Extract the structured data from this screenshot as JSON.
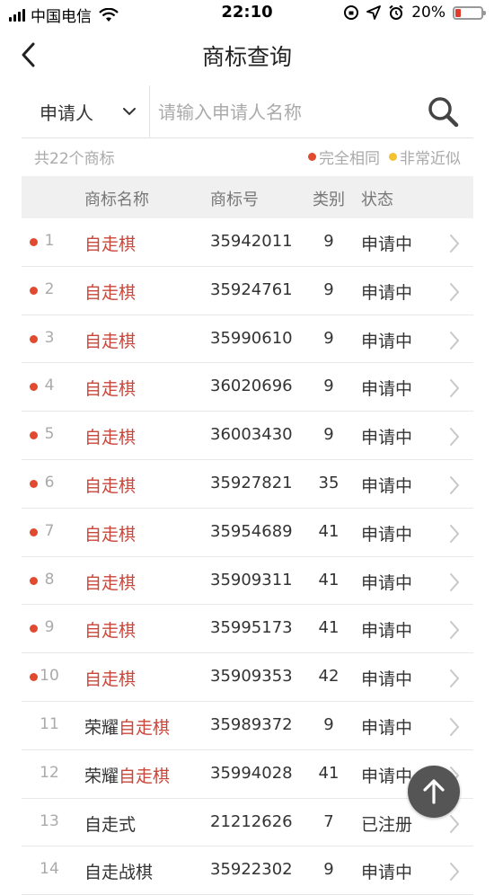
{
  "status_bar": {
    "carrier": "中国电信",
    "time": "22:10",
    "battery": "20%",
    "battery_level": 0.2
  },
  "nav": {
    "title": "商标查询"
  },
  "search": {
    "type_label": "申请人",
    "placeholder": "请输入申请人名称"
  },
  "summary": {
    "count": "共22个商标",
    "legend_exact": "完全相同",
    "legend_similar": "非常近似",
    "exact_color": "#e04a2e",
    "similar_color": "#f2c230"
  },
  "table": {
    "headers": {
      "name": "商标名称",
      "number": "商标号",
      "class": "类别",
      "status": "状态"
    },
    "rows": [
      {
        "index": "1",
        "prefix": "",
        "highlight": "自走棋",
        "number": "35942011",
        "class": "9",
        "status": "申请中",
        "exact": true
      },
      {
        "index": "2",
        "prefix": "",
        "highlight": "自走棋",
        "number": "35924761",
        "class": "9",
        "status": "申请中",
        "exact": true
      },
      {
        "index": "3",
        "prefix": "",
        "highlight": "自走棋",
        "number": "35990610",
        "class": "9",
        "status": "申请中",
        "exact": true
      },
      {
        "index": "4",
        "prefix": "",
        "highlight": "自走棋",
        "number": "36020696",
        "class": "9",
        "status": "申请中",
        "exact": true
      },
      {
        "index": "5",
        "prefix": "",
        "highlight": "自走棋",
        "number": "36003430",
        "class": "9",
        "status": "申请中",
        "exact": true
      },
      {
        "index": "6",
        "prefix": "",
        "highlight": "自走棋",
        "number": "35927821",
        "class": "35",
        "status": "申请中",
        "exact": true
      },
      {
        "index": "7",
        "prefix": "",
        "highlight": "自走棋",
        "number": "35954689",
        "class": "41",
        "status": "申请中",
        "exact": true
      },
      {
        "index": "8",
        "prefix": "",
        "highlight": "自走棋",
        "number": "35909311",
        "class": "41",
        "status": "申请中",
        "exact": true
      },
      {
        "index": "9",
        "prefix": "",
        "highlight": "自走棋",
        "number": "35995173",
        "class": "41",
        "status": "申请中",
        "exact": true
      },
      {
        "index": "10",
        "prefix": "",
        "highlight": "自走棋",
        "number": "35909353",
        "class": "42",
        "status": "申请中",
        "exact": true
      },
      {
        "index": "11",
        "prefix": "荣耀",
        "highlight": "自走棋",
        "number": "35989372",
        "class": "9",
        "status": "申请中",
        "exact": false
      },
      {
        "index": "12",
        "prefix": "荣耀",
        "highlight": "自走棋",
        "number": "35994028",
        "class": "41",
        "status": "申请中",
        "exact": false
      },
      {
        "index": "13",
        "prefix": "自走式",
        "highlight": "",
        "number": "21212626",
        "class": "7",
        "status": "已注册",
        "exact": false
      },
      {
        "index": "14",
        "prefix": "自走战棋",
        "highlight": "",
        "number": "35922302",
        "class": "9",
        "status": "申请中",
        "exact": false
      }
    ]
  }
}
